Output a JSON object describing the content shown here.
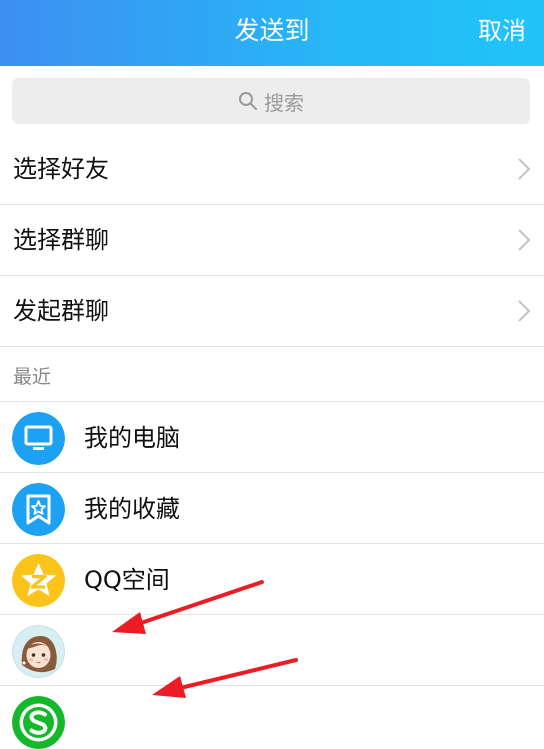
{
  "header": {
    "title": "发送到",
    "cancel_label": "取消"
  },
  "search": {
    "placeholder": "搜索"
  },
  "menu": [
    {
      "label": "选择好友"
    },
    {
      "label": "选择群聊"
    },
    {
      "label": "发起群聊"
    }
  ],
  "recent": {
    "section_label": "最近",
    "items": [
      {
        "name": "我的电脑",
        "icon": "computer-icon",
        "color": "#1da1f2"
      },
      {
        "name": "我的收藏",
        "icon": "favorites-icon",
        "color": "#1da1f2"
      },
      {
        "name": "QQ空间",
        "icon": "qzone-icon",
        "color": "#fcc31a"
      },
      {
        "name": "",
        "icon": "user-avatar",
        "color": "#cfe9ee"
      },
      {
        "name": "",
        "icon": "s-app-icon",
        "color": "#14b82a"
      }
    ]
  },
  "colors": {
    "header_start": "#3d8ff2",
    "header_end": "#20c4fa",
    "annotation_arrow": "#ec1c24"
  }
}
